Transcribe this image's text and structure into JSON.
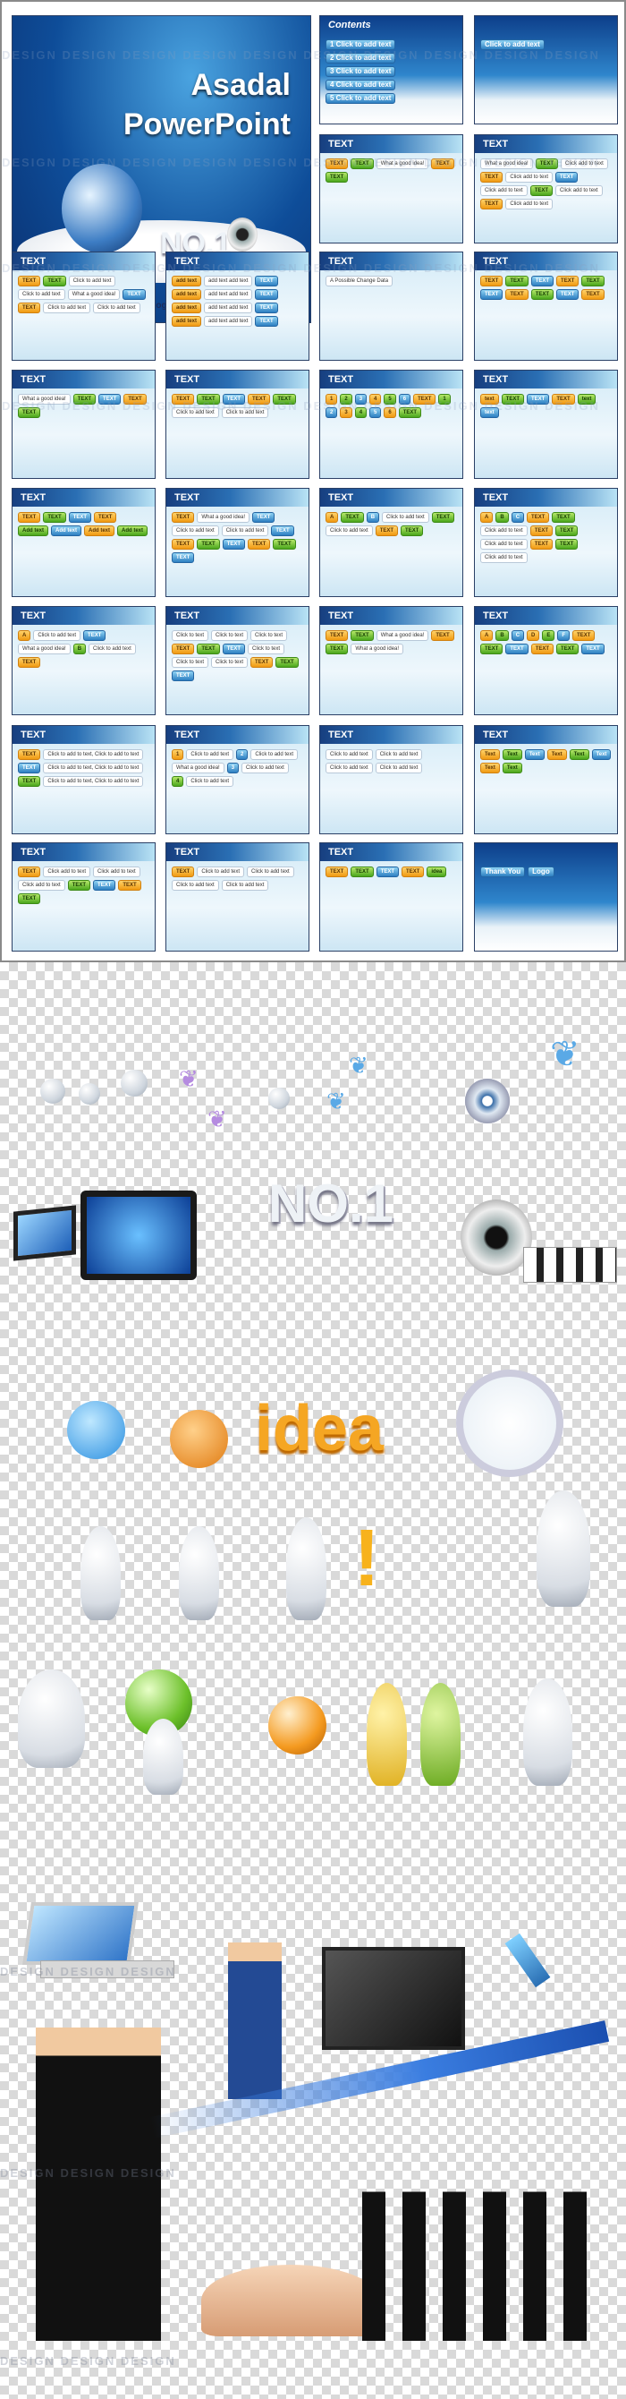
{
  "watermark": "DESIGN DESIGN DESIGN DESIGN DESIGN DESIGN DESIGN DESIGN DESIGN DESIGN",
  "cover": {
    "title": "Asadal",
    "subtitle": "PowerPoint",
    "badge": "NO.1",
    "logo": "Logo"
  },
  "slides": [
    {
      "title": "Contents",
      "items": [
        "1 Click to add text",
        "2 Click to add text",
        "3 Click to add text",
        "4 Click to add text",
        "5 Click to add text"
      ],
      "dark": true
    },
    {
      "title": "",
      "items": [
        "Click to add text"
      ],
      "dark": true
    },
    {
      "title": "TEXT",
      "items": [
        "TEXT",
        "TEXT",
        "What a good idea!",
        "TEXT",
        "TEXT"
      ]
    },
    {
      "title": "TEXT",
      "items": [
        "What a good idea!",
        "TEXT",
        "Click add to text",
        "TEXT",
        "Click add to text",
        "TEXT",
        "Click add to text",
        "TEXT",
        "Click add to text",
        "TEXT",
        "Click add to text"
      ]
    },
    {
      "title": "TEXT",
      "items": [
        "TEXT",
        "TEXT",
        "Click to add text",
        "Click to add text",
        "What a good idea!",
        "TEXT",
        "TEXT",
        "Click to add text",
        "Click to add text"
      ]
    },
    {
      "title": "TEXT",
      "items": [
        "add text",
        "add text add text",
        "TEXT",
        "add text",
        "add text add text",
        "TEXT",
        "add text",
        "add text add text",
        "TEXT",
        "add text",
        "add text add text",
        "TEXT"
      ]
    },
    {
      "title": "TEXT",
      "items": [
        "A Possible Change Data"
      ]
    },
    {
      "title": "TEXT",
      "items": [
        "TEXT",
        "TEXT",
        "TEXT",
        "TEXT",
        "TEXT",
        "TEXT",
        "TEXT",
        "TEXT",
        "TEXT",
        "TEXT"
      ]
    },
    {
      "title": "TEXT",
      "items": [
        "What a good idea!",
        "TEXT",
        "TEXT",
        "TEXT",
        "TEXT"
      ]
    },
    {
      "title": "TEXT",
      "items": [
        "TEXT",
        "TEXT",
        "TEXT",
        "TEXT",
        "TEXT",
        "Click to add text",
        "Click to add text"
      ]
    },
    {
      "title": "TEXT",
      "items": [
        "1",
        "2",
        "3",
        "4",
        "5",
        "6",
        "TEXT",
        "1",
        "2",
        "3",
        "4",
        "5",
        "6",
        "TEXT"
      ]
    },
    {
      "title": "TEXT",
      "items": [
        "text",
        "TEXT",
        "TEXT",
        "TEXT",
        "text",
        "text"
      ]
    },
    {
      "title": "TEXT",
      "items": [
        "TEXT",
        "TEXT",
        "TEXT",
        "TEXT",
        "Add text",
        "Add text",
        "Add text",
        "Add text"
      ]
    },
    {
      "title": "TEXT",
      "items": [
        "TEXT",
        "What a good idea!",
        "TEXT",
        "Click to add text",
        "Click to add text",
        "TEXT",
        "TEXT",
        "TEXT",
        "TEXT",
        "TEXT",
        "TEXT",
        "TEXT"
      ]
    },
    {
      "title": "TEXT",
      "items": [
        "A",
        "TEXT",
        "B",
        "Click to add text",
        "TEXT",
        "Click to add text",
        "TEXT",
        "TEXT"
      ]
    },
    {
      "title": "TEXT",
      "items": [
        "A",
        "B",
        "C",
        "TEXT",
        "TEXT",
        "Click add to text",
        "TEXT",
        "TEXT",
        "Click add to text",
        "TEXT",
        "TEXT",
        "Click add to text"
      ]
    },
    {
      "title": "TEXT",
      "items": [
        "A",
        "Click to add text",
        "TEXT",
        "What a good idea!",
        "B",
        "Click to add text",
        "TEXT"
      ]
    },
    {
      "title": "TEXT",
      "items": [
        "Click to text",
        "Click to text",
        "Click to text",
        "TEXT",
        "TEXT",
        "TEXT",
        "Click to text",
        "Click to text",
        "Click to text",
        "TEXT",
        "TEXT",
        "TEXT"
      ]
    },
    {
      "title": "TEXT",
      "items": [
        "TEXT",
        "TEXT",
        "What a good idea!",
        "TEXT",
        "TEXT",
        "What a good idea!"
      ]
    },
    {
      "title": "TEXT",
      "items": [
        "A",
        "B",
        "C",
        "D",
        "E",
        "F",
        "TEXT",
        "TEXT",
        "TEXT",
        "TEXT",
        "TEXT",
        "TEXT"
      ]
    },
    {
      "title": "TEXT",
      "items": [
        "TEXT",
        "Click to add to text, Click to add to text",
        "TEXT",
        "Click to add to text, Click to add to text",
        "TEXT",
        "Click to add to text, Click to add to text"
      ]
    },
    {
      "title": "TEXT",
      "items": [
        "1",
        "Click to add text",
        "2",
        "Click to add text",
        "What a good idea!",
        "3",
        "Click to add text",
        "4",
        "Click to add text"
      ]
    },
    {
      "title": "TEXT",
      "items": [
        "Click to add text",
        "Click to add text",
        "Click to add text",
        "Click to add text"
      ]
    },
    {
      "title": "TEXT",
      "items": [
        "Text",
        "Text",
        "Text",
        "Text",
        "Text",
        "Text",
        "Text",
        "Text"
      ]
    },
    {
      "title": "TEXT",
      "items": [
        "TEXT",
        "Click add to text",
        "Click add to text",
        "Click add to text",
        "TEXT",
        "TEXT",
        "TEXT",
        "TEXT"
      ]
    },
    {
      "title": "TEXT",
      "items": [
        "TEXT",
        "Click to add text",
        "Click to add text",
        "Click to add text",
        "Click to add text"
      ]
    },
    {
      "title": "TEXT",
      "items": [
        "TEXT",
        "TEXT",
        "TEXT",
        "TEXT",
        "idea"
      ]
    },
    {
      "title": "",
      "items": [
        "Thank You",
        "Logo"
      ],
      "dark": true
    }
  ],
  "clipart": {
    "badge": "NO.1",
    "idea": "idea",
    "watermark": "DESIGN DESIGN DESIGN"
  }
}
